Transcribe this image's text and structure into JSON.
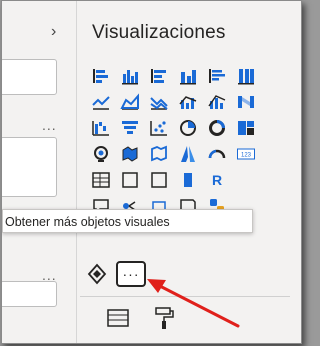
{
  "pane": {
    "title": "Visualizaciones",
    "collapse_glyph": "›",
    "left_ellipsis": "..."
  },
  "icons": [
    [
      "stacked-bar-icon",
      "clustered-bar-icon",
      "100pct-bar-icon",
      "stacked-column-icon",
      "clustered-column-icon",
      "100pct-column-icon"
    ],
    [
      "line-icon",
      "area-icon",
      "stacked-area-icon",
      "line-clustered-column-icon",
      "line-stacked-column-icon",
      "ribbon-icon"
    ],
    [
      "waterfall-icon",
      "funnel-icon",
      "scatter-icon",
      "pie-icon",
      "donut-icon",
      "treemap-icon"
    ],
    [
      "map-icon",
      "filled-map-icon",
      "shape-map-icon",
      "azure-map-icon",
      "gauge-icon",
      "card-icon"
    ],
    [
      "table-icon",
      "slicer-icon",
      "kpi-icon",
      "r-visual-icon"
    ],
    [
      "qa-icon",
      "paginated-icon",
      "python-icon"
    ]
  ],
  "tooltip": {
    "text": "Obtener más objetos visuales"
  },
  "more_visuals": {
    "label": "···"
  },
  "r_label": "R",
  "card_label": "123",
  "colors": {
    "accent": "#1a6ad6",
    "arrow": "#e0201b",
    "panel_bg": "#f3f2f1"
  }
}
